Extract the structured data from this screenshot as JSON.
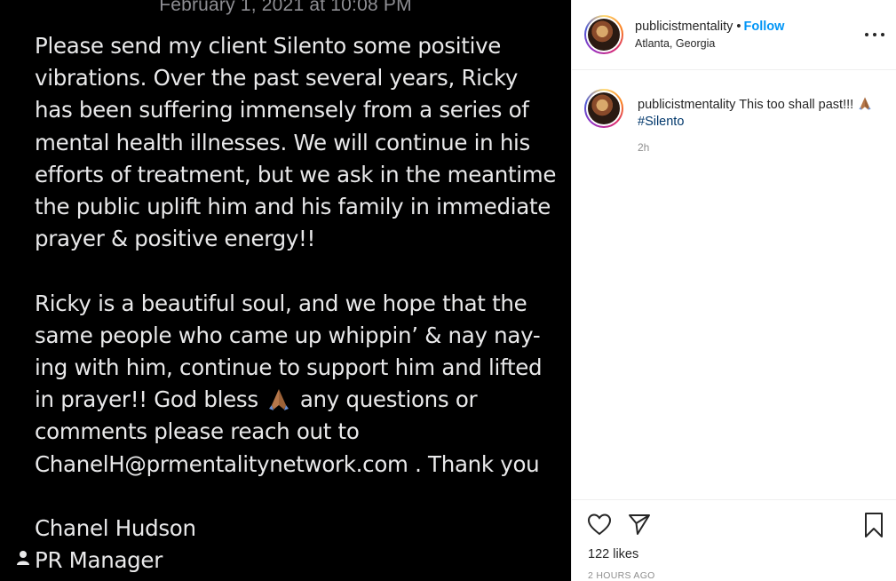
{
  "post_image": {
    "date": "February 1, 2021 at 10:08 PM",
    "paragraph1": "Please send my client Silento some positive vibrations. Over the past several years, Ricky has been suffering immensely from a series of mental health illnesses. We will continue in his efforts of treatment, but we ask in the meantime the public uplift him and his family in immediate prayer & positive energy!!",
    "paragraph2_before": "Ricky is a beautiful soul, and we hope that the same people who came up whippin’ & nay nay-ing with him, continue to support him and lifted in prayer!! God bless",
    "paragraph2_after": "any questions or comments please reach out to ChanelH@prmentalitynetwork.com . Thank you",
    "signature_name": "Chanel Hudson",
    "signature_title": "PR Manager"
  },
  "header": {
    "username": "publicistmentality",
    "separator": "•",
    "follow_label": "Follow",
    "location": "Atlanta, Georgia"
  },
  "caption": {
    "username": "publicistmentality",
    "text": "This too shall past!!!",
    "hashtag": "#Silento",
    "time": "2h"
  },
  "actions": {
    "likes": "122 likes",
    "time_ago": "2 HOURS AGO"
  },
  "icons": {
    "like": "heart-icon",
    "share": "send-icon",
    "save": "bookmark-icon",
    "more": "more-options-icon",
    "emoji": "folded-hands-emoji"
  },
  "colors": {
    "link_blue": "#0095f6",
    "hashtag": "#00376b",
    "text": "#262626",
    "muted": "#8e8e8e",
    "image_bg": "#000000"
  }
}
